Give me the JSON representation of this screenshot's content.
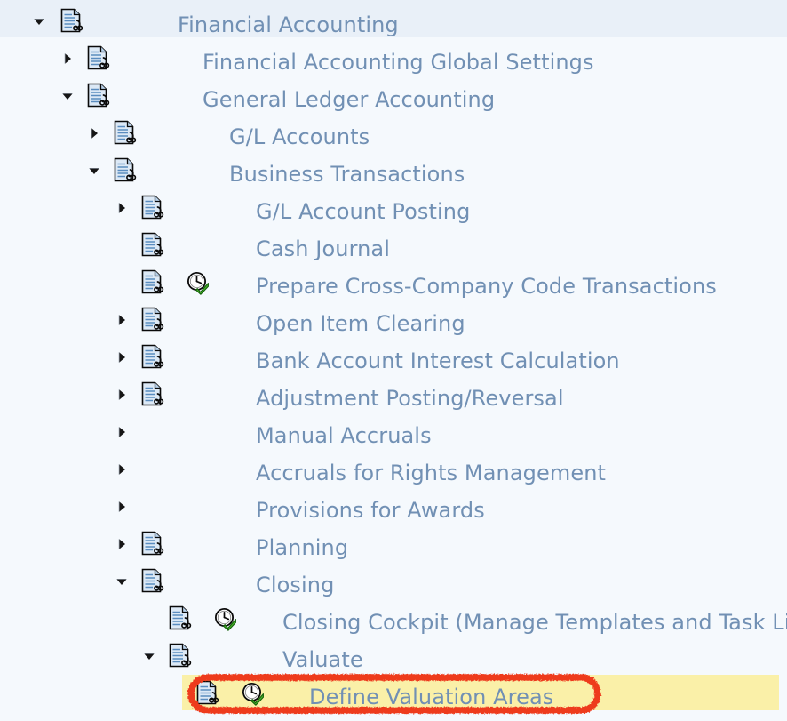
{
  "app": {
    "type": "sap-img-tree",
    "title": "Financial Accounting",
    "text_color": "#7190B4",
    "row_bg": "#F5F9FD",
    "first_row_bg": "#E9F0F8",
    "highlight_color": "#FAF0A8",
    "annotation_color": "#EE3B1E"
  },
  "tree": {
    "nodes": [
      {
        "label": "Financial Accounting",
        "level": 0,
        "toggle": "expanded",
        "toggle_icon": "triangle-down-icon",
        "doc_icon": "img-activity-document-icon",
        "clock_icon": null,
        "selected": true,
        "highlighted": false
      },
      {
        "label": "Financial Accounting Global Settings",
        "level": 1,
        "toggle": "collapsed",
        "toggle_icon": "triangle-right-icon",
        "doc_icon": "img-activity-document-icon",
        "clock_icon": null,
        "selected": false,
        "highlighted": false
      },
      {
        "label": "General Ledger Accounting",
        "level": 1,
        "toggle": "expanded",
        "toggle_icon": "triangle-down-icon",
        "doc_icon": "img-activity-document-icon",
        "clock_icon": null,
        "selected": false,
        "highlighted": false
      },
      {
        "label": "G/L Accounts",
        "level": 2,
        "toggle": "collapsed",
        "toggle_icon": "triangle-right-icon",
        "doc_icon": "img-activity-document-icon",
        "clock_icon": null,
        "selected": false,
        "highlighted": false
      },
      {
        "label": "Business Transactions",
        "level": 2,
        "toggle": "expanded",
        "toggle_icon": "triangle-down-icon",
        "doc_icon": "img-activity-document-icon",
        "clock_icon": null,
        "selected": false,
        "highlighted": false
      },
      {
        "label": "G/L Account Posting",
        "level": 3,
        "toggle": "collapsed",
        "toggle_icon": "triangle-right-icon",
        "doc_icon": "img-activity-document-icon",
        "clock_icon": null,
        "selected": false,
        "highlighted": false
      },
      {
        "label": "Cash Journal",
        "level": 3,
        "toggle": "none",
        "toggle_icon": null,
        "doc_icon": "img-activity-document-icon",
        "clock_icon": null,
        "selected": false,
        "highlighted": false
      },
      {
        "label": "Prepare Cross-Company Code Transactions",
        "level": 3,
        "toggle": "none",
        "toggle_icon": null,
        "doc_icon": "img-activity-document-icon",
        "clock_icon": "clock-check-icon",
        "selected": false,
        "highlighted": false
      },
      {
        "label": "Open Item Clearing",
        "level": 3,
        "toggle": "collapsed",
        "toggle_icon": "triangle-right-icon",
        "doc_icon": "img-activity-document-icon",
        "clock_icon": null,
        "selected": false,
        "highlighted": false
      },
      {
        "label": "Bank Account Interest Calculation",
        "level": 3,
        "toggle": "collapsed",
        "toggle_icon": "triangle-right-icon",
        "doc_icon": "img-activity-document-icon",
        "clock_icon": null,
        "selected": false,
        "highlighted": false
      },
      {
        "label": "Adjustment Posting/Reversal",
        "level": 3,
        "toggle": "collapsed",
        "toggle_icon": "triangle-right-icon",
        "doc_icon": "img-activity-document-icon",
        "clock_icon": null,
        "selected": false,
        "highlighted": false
      },
      {
        "label": "Manual Accruals",
        "level": 3,
        "toggle": "collapsed",
        "toggle_icon": "triangle-right-icon",
        "doc_icon": null,
        "clock_icon": null,
        "selected": false,
        "highlighted": false
      },
      {
        "label": "Accruals for Rights Management",
        "level": 3,
        "toggle": "collapsed",
        "toggle_icon": "triangle-right-icon",
        "doc_icon": null,
        "clock_icon": null,
        "selected": false,
        "highlighted": false
      },
      {
        "label": "Provisions for Awards",
        "level": 3,
        "toggle": "collapsed",
        "toggle_icon": "triangle-right-icon",
        "doc_icon": null,
        "clock_icon": null,
        "selected": false,
        "highlighted": false
      },
      {
        "label": "Planning",
        "level": 3,
        "toggle": "collapsed",
        "toggle_icon": "triangle-right-icon",
        "doc_icon": "img-activity-document-icon",
        "clock_icon": null,
        "selected": false,
        "highlighted": false
      },
      {
        "label": "Closing",
        "level": 3,
        "toggle": "expanded",
        "toggle_icon": "triangle-down-icon",
        "doc_icon": "img-activity-document-icon",
        "clock_icon": null,
        "selected": false,
        "highlighted": false
      },
      {
        "label": "Closing Cockpit (Manage Templates and Task Lists)",
        "level": 4,
        "toggle": "none",
        "toggle_icon": null,
        "doc_icon": "img-activity-document-icon",
        "clock_icon": "clock-check-icon",
        "selected": false,
        "highlighted": false
      },
      {
        "label": "Valuate",
        "level": 4,
        "toggle": "expanded",
        "toggle_icon": "triangle-down-icon",
        "doc_icon": "img-activity-document-icon",
        "clock_icon": null,
        "selected": false,
        "highlighted": false
      },
      {
        "label": "Define Valuation Areas",
        "level": 5,
        "toggle": "none",
        "toggle_icon": null,
        "doc_icon": "img-activity-document-icon",
        "clock_icon": "clock-check-icon",
        "selected": false,
        "highlighted": true
      }
    ]
  },
  "annotation": {
    "shape": "hand-drawn-ellipse",
    "color": "#EE3B1E",
    "target_label": "Define Valuation Areas"
  }
}
